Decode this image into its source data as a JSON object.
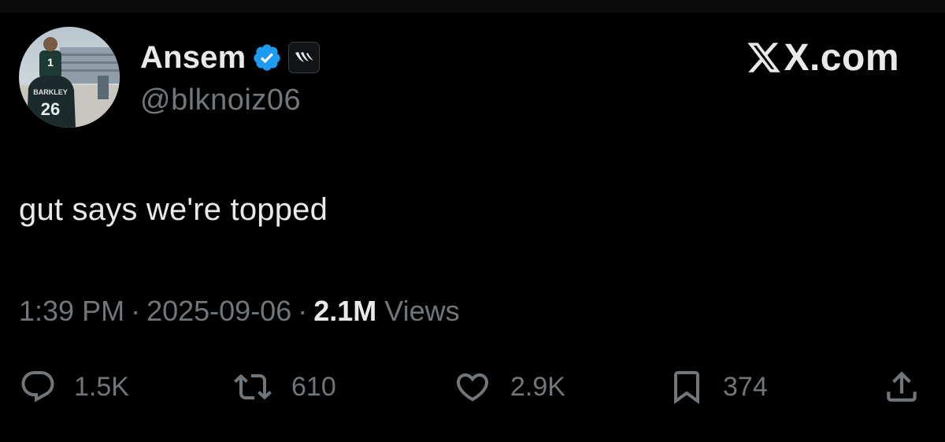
{
  "author": {
    "display_name": "Ansem",
    "handle": "@blknoiz06",
    "verified": true,
    "avatar_jersey_number": "26",
    "avatar_jersey_name": "BARKLEY",
    "avatar_jersey_top_number": "1"
  },
  "brand": {
    "label": "X.com"
  },
  "tweet": {
    "text": "gut says we're topped"
  },
  "meta": {
    "time": "1:39 PM",
    "separator": "·",
    "date": "2025-09-06",
    "views_count": "2.1M",
    "views_label": "Views"
  },
  "actions": {
    "replies": "1.5K",
    "reposts": "610",
    "likes": "2.9K",
    "bookmarks": "374"
  },
  "colors": {
    "background": "#000000",
    "primary_text": "#e7e9ea",
    "secondary_text": "#71767b",
    "verified_blue": "#1d9bf0"
  },
  "icons": {
    "verified": "verified-badge-icon",
    "affiliate": "affiliate-logo-icon",
    "reply": "reply-icon",
    "repost": "repost-icon",
    "like": "heart-icon",
    "bookmark": "bookmark-icon",
    "share": "share-icon",
    "brand": "x-logo-icon"
  }
}
